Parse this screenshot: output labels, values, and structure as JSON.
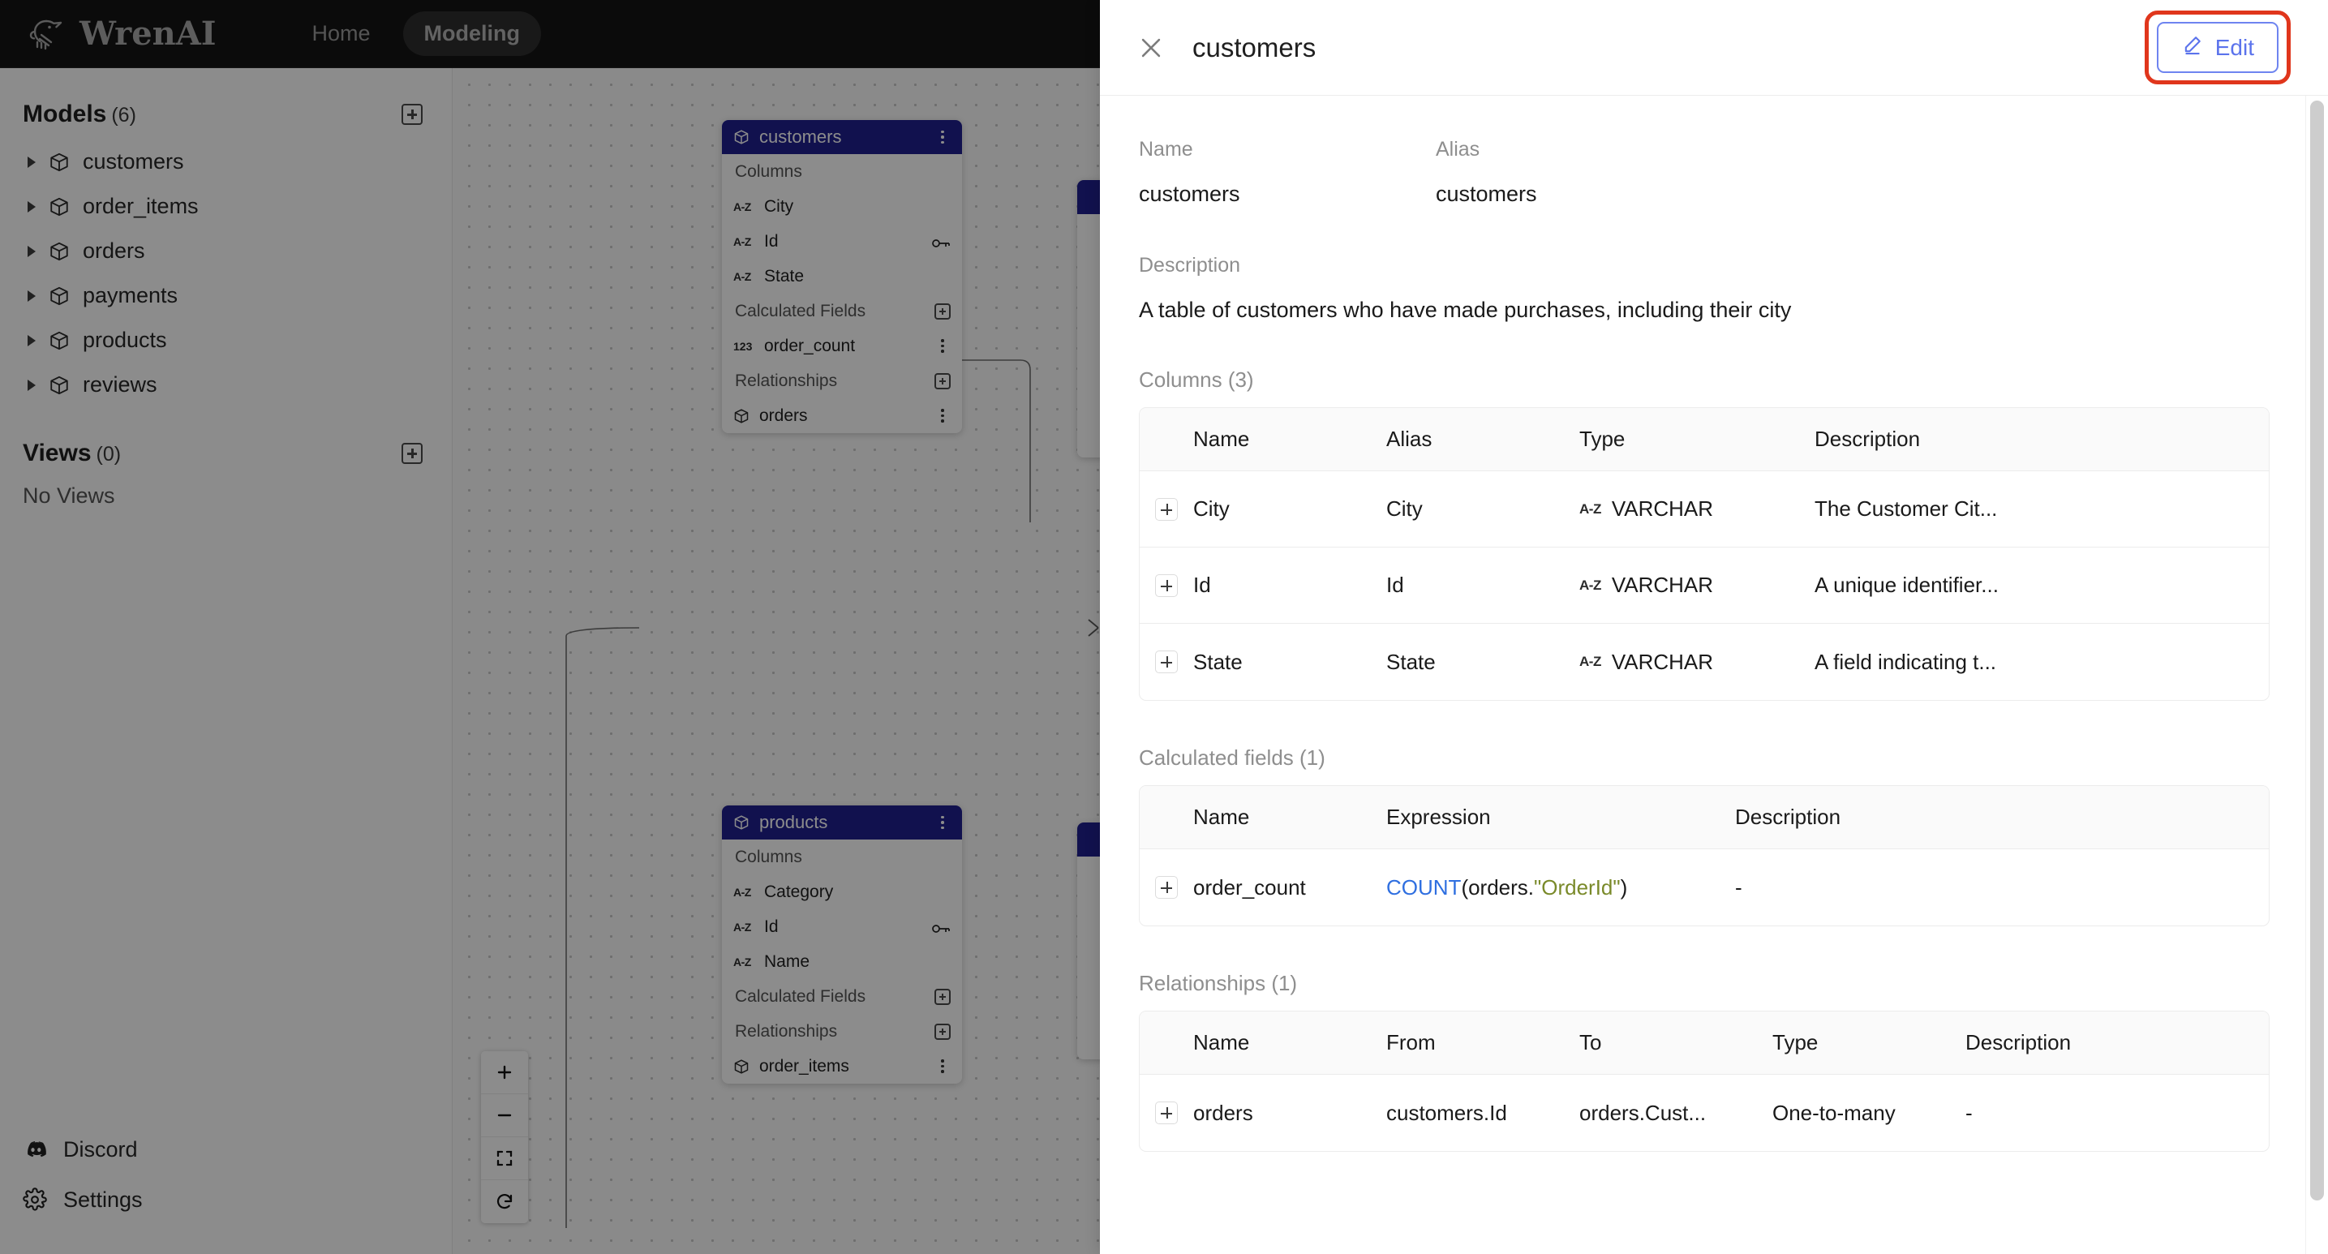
{
  "topnav": {
    "brand": "WrenAI",
    "links": [
      {
        "label": "Home",
        "active": false
      },
      {
        "label": "Modeling",
        "active": true
      }
    ]
  },
  "sidebar": {
    "models_title": "Models",
    "models_count": "(6)",
    "models": [
      {
        "label": "customers"
      },
      {
        "label": "order_items"
      },
      {
        "label": "orders"
      },
      {
        "label": "payments"
      },
      {
        "label": "products"
      },
      {
        "label": "reviews"
      }
    ],
    "views_title": "Views",
    "views_count": "(0)",
    "views_empty": "No Views",
    "footer": [
      {
        "label": "Discord",
        "icon": "discord-icon"
      },
      {
        "label": "Settings",
        "icon": "gear-icon"
      }
    ]
  },
  "canvas": {
    "nodes": [
      {
        "title": "customers",
        "rows": [
          {
            "kind": "group",
            "label": "Columns",
            "trailing": "none"
          },
          {
            "kind": "column",
            "icon": "az",
            "label": "City",
            "trailing": "none"
          },
          {
            "kind": "column",
            "icon": "az",
            "label": "Id",
            "trailing": "key"
          },
          {
            "kind": "column",
            "icon": "az",
            "label": "State",
            "trailing": "none"
          },
          {
            "kind": "group",
            "label": "Calculated Fields",
            "trailing": "plus"
          },
          {
            "kind": "column",
            "icon": "123",
            "label": "order_count",
            "trailing": "dots"
          },
          {
            "kind": "group",
            "label": "Relationships",
            "trailing": "plus"
          },
          {
            "kind": "relation",
            "icon": "cube",
            "label": "orders",
            "trailing": "dots"
          }
        ]
      },
      {
        "title": "products",
        "rows": [
          {
            "kind": "group",
            "label": "Columns",
            "trailing": "none"
          },
          {
            "kind": "column",
            "icon": "az",
            "label": "Category",
            "trailing": "none"
          },
          {
            "kind": "column",
            "icon": "az",
            "label": "Id",
            "trailing": "key"
          },
          {
            "kind": "column",
            "icon": "az",
            "label": "Name",
            "trailing": "none"
          },
          {
            "kind": "group",
            "label": "Calculated Fields",
            "trailing": "plus"
          },
          {
            "kind": "group",
            "label": "Relationships",
            "trailing": "plus"
          },
          {
            "kind": "relation",
            "icon": "cube",
            "label": "order_items",
            "trailing": "dots"
          }
        ]
      }
    ],
    "controls": [
      {
        "name": "zoom-in-button",
        "icon": "plus-icon"
      },
      {
        "name": "zoom-out-button",
        "icon": "minus-icon"
      },
      {
        "name": "fit-view-button",
        "icon": "fit-view-icon"
      },
      {
        "name": "reset-button",
        "icon": "reload-icon"
      }
    ]
  },
  "drawer": {
    "title": "customers",
    "edit_label": "Edit",
    "name_label": "Name",
    "name_value": "customers",
    "alias_label": "Alias",
    "alias_value": "customers",
    "description_label": "Description",
    "description_value": "A table of customers who have made purchases, including their city",
    "columns": {
      "section_title": "Columns (3)",
      "headers": [
        "Name",
        "Alias",
        "Type",
        "Description"
      ],
      "rows": [
        {
          "name": "City",
          "alias": "City",
          "type": "VARCHAR",
          "type_icon": "A-Z",
          "description": "The Customer Cit..."
        },
        {
          "name": "Id",
          "alias": "Id",
          "type": "VARCHAR",
          "type_icon": "A-Z",
          "description": "A unique identifier..."
        },
        {
          "name": "State",
          "alias": "State",
          "type": "VARCHAR",
          "type_icon": "A-Z",
          "description": "A field indicating t..."
        }
      ]
    },
    "calculated_fields": {
      "section_title": "Calculated fields (1)",
      "headers": [
        "Name",
        "Expression",
        "Description"
      ],
      "rows": [
        {
          "name": "order_count",
          "expression_fn": "COUNT",
          "expression_mid": "(orders.",
          "expression_str": "\"OrderId\"",
          "expression_end": ")",
          "description": "-"
        }
      ]
    },
    "relationships": {
      "section_title": "Relationships (1)",
      "headers": [
        "Name",
        "From",
        "To",
        "Type",
        "Description"
      ],
      "rows": [
        {
          "name": "orders",
          "from": "customers.Id",
          "to": "orders.Cust...",
          "type": "One-to-many",
          "description": "-"
        }
      ]
    }
  },
  "colors": {
    "node_header": "#1f1f8f",
    "edit_blue": "#5b73ec",
    "highlight_red": "#e0361c",
    "nav_dark": "#151515"
  }
}
